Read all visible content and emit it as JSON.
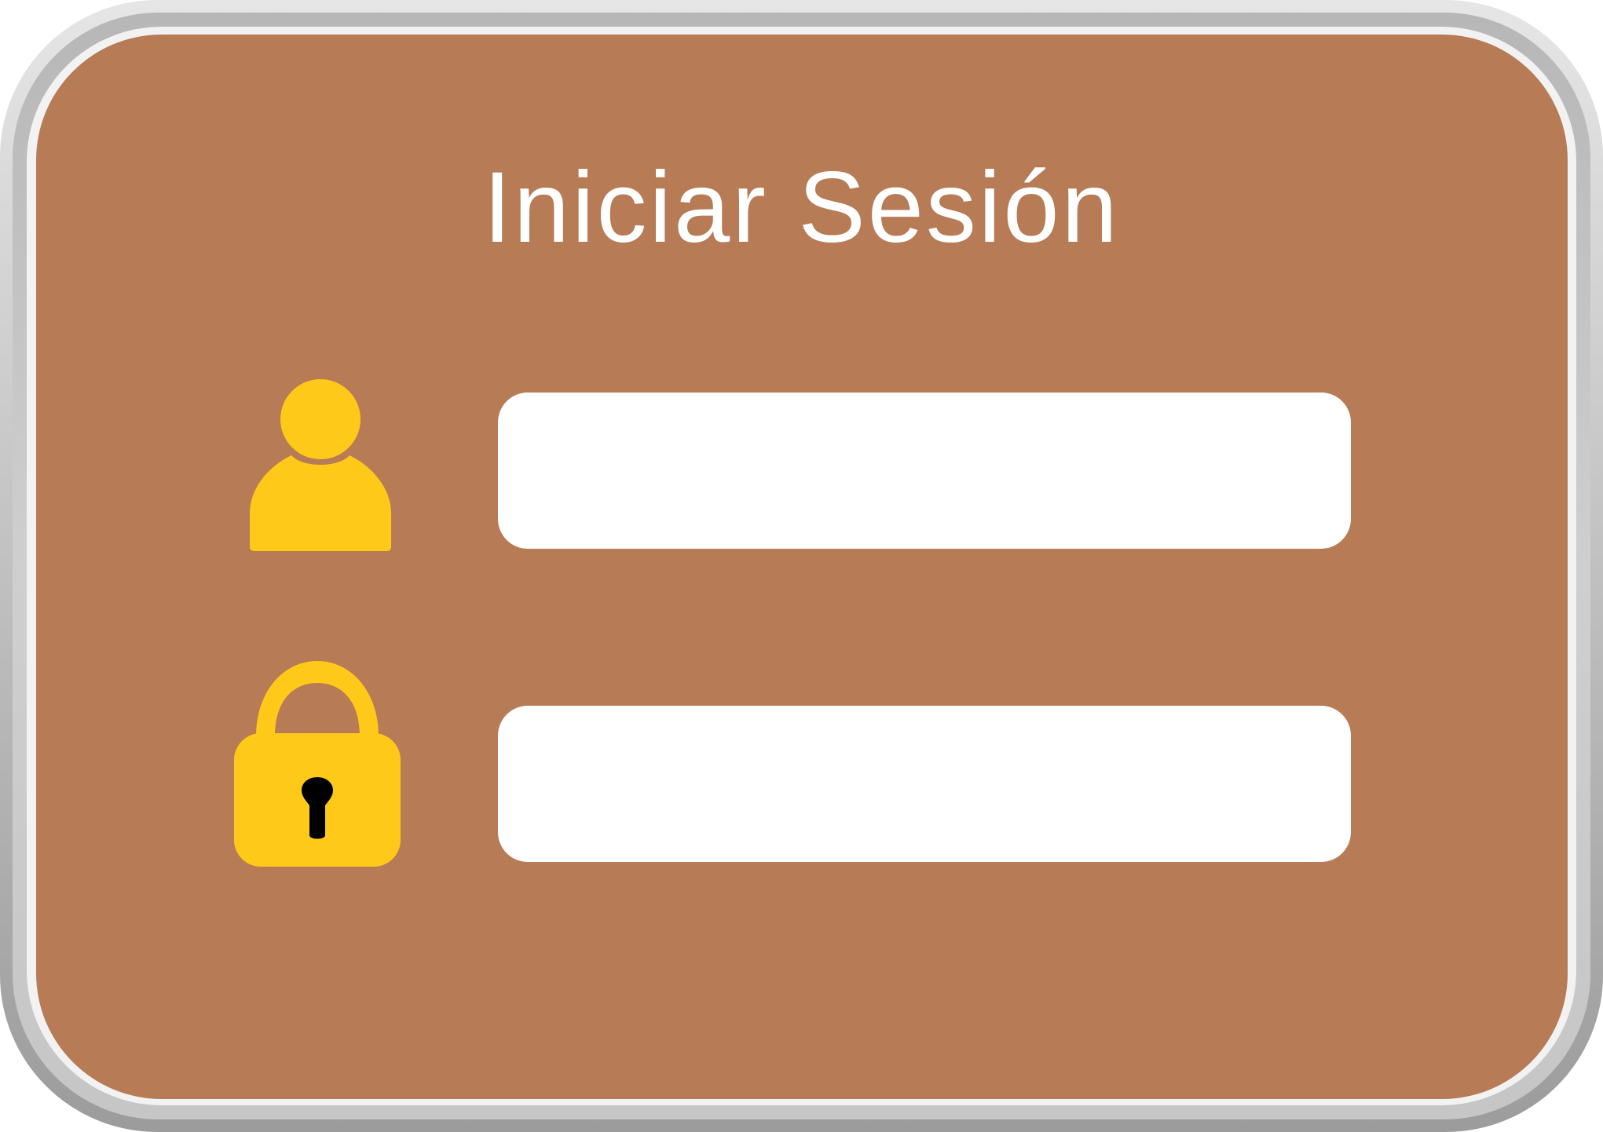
{
  "login_card": {
    "title": "Iniciar Sesión",
    "username": {
      "icon": "user-icon",
      "value": "",
      "placeholder": ""
    },
    "password": {
      "icon": "lock-icon",
      "value": "",
      "placeholder": ""
    }
  },
  "colors": {
    "panel_background": "#b77b56",
    "icon_fill": "#ffc919",
    "field_background": "#ffffff",
    "title_text": "#ffffff",
    "keyhole": "#000000"
  }
}
